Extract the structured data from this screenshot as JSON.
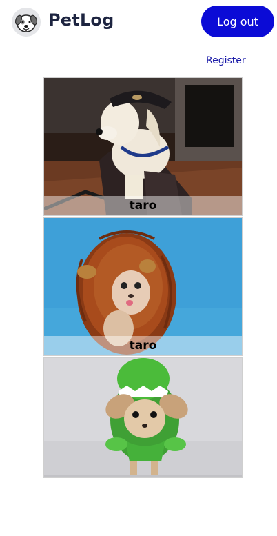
{
  "header": {
    "app_title": "PetLog",
    "logout_label": "Log out",
    "logo_icon": "dog-face-icon"
  },
  "nav": {
    "register_label": "Register"
  },
  "colors": {
    "primary": "#0b0bd6",
    "title": "#1d2440",
    "link": "#1a1aa8"
  },
  "pets": [
    {
      "name": "taro",
      "photo": "dog in black cap and jacket"
    },
    {
      "name": "taro",
      "photo": "chihuahua in lion mane costume"
    },
    {
      "name": "",
      "photo": "chihuahua in green dinosaur costume"
    }
  ]
}
